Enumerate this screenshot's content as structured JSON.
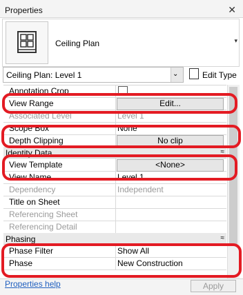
{
  "window": {
    "title": "Properties",
    "close_glyph": "✕"
  },
  "type_selector": {
    "name": "Ceiling Plan",
    "icon": "ceiling-plan-icon",
    "arrow_glyph": "▾"
  },
  "view_selector": {
    "value": "Ceiling Plan: Level 1",
    "arrow_glyph": "⌄"
  },
  "edit_type": {
    "label": "Edit Type",
    "icon": "edit-type-icon"
  },
  "rows": [
    {
      "label": "Annotation Crop"
    },
    {
      "label": "View Range",
      "value": "Edit..."
    },
    {
      "label": "Associated Level",
      "value": "Level 1"
    },
    {
      "label": "Scope Box",
      "value": "None"
    },
    {
      "label": "Depth Clipping",
      "value": "No clip"
    }
  ],
  "identity_group": {
    "label": "Identity Data",
    "chevron": "≈"
  },
  "identity_rows": [
    {
      "label": "View Template",
      "value": "<None>"
    },
    {
      "label": "View Name",
      "value": "Level 1"
    },
    {
      "label": "Dependency",
      "value": "Independent"
    },
    {
      "label": "Title on Sheet",
      "value": ""
    },
    {
      "label": "Referencing Sheet",
      "value": ""
    },
    {
      "label": "Referencing Detail",
      "value": ""
    }
  ],
  "phasing_group": {
    "label": "Phasing",
    "chevron": "≈"
  },
  "phasing_rows": [
    {
      "label": "Phase Filter",
      "value": "Show All"
    },
    {
      "label": "Phase",
      "value": "New Construction"
    }
  ],
  "footer": {
    "help_link": "Properties help",
    "apply_label": "Apply"
  },
  "colors": {
    "annotation_red": "#e31b23",
    "link_blue": "#1f5fbf",
    "group_bg": "#e9e9e9"
  }
}
